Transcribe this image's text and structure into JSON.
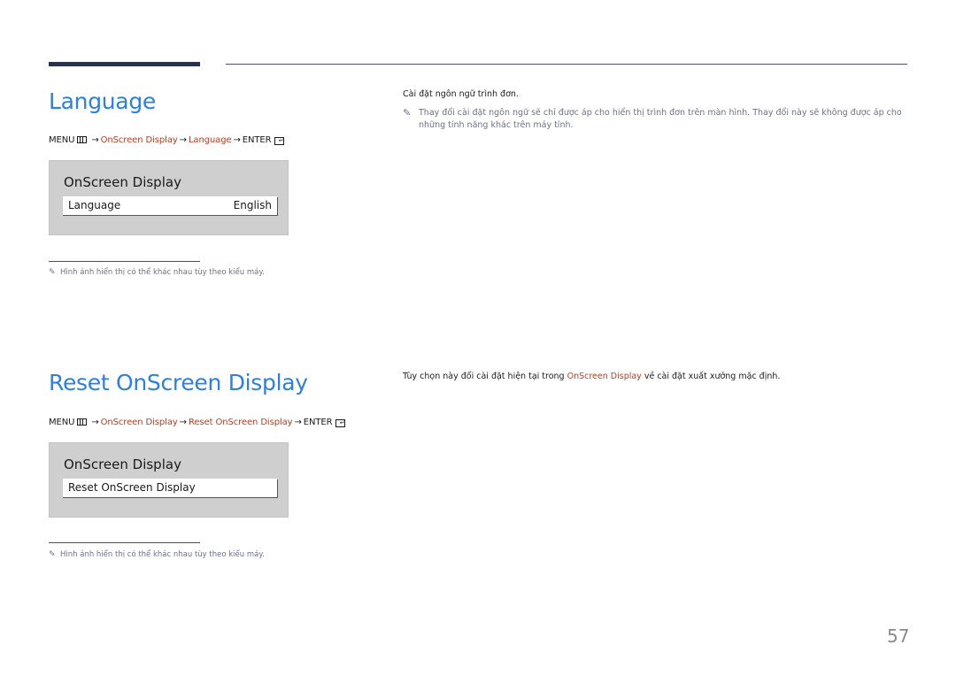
{
  "page_number": "57",
  "sections": [
    {
      "title": "Language",
      "menu_path": {
        "menu": "MENU",
        "arrow": "→",
        "step1": "OnScreen Display",
        "step2": "Language",
        "enter": "ENTER"
      },
      "osd": {
        "title": "OnScreen Display",
        "item_label": "Language",
        "item_value": "English"
      },
      "footnote": "Hình ảnh hiển thị có thể khác nhau tùy theo kiểu máy.",
      "description": "Cài đặt ngôn ngữ trình đơn.",
      "note": "Thay đổi cài đặt ngôn ngữ sẽ chỉ được áp cho hiển thị trình đơn trên màn hình. Thay đổi này sẽ không được áp cho những tính năng khác trên máy tính."
    },
    {
      "title": "Reset OnScreen Display",
      "menu_path": {
        "menu": "MENU",
        "arrow": "→",
        "step1": "OnScreen Display",
        "step2": "Reset OnScreen Display",
        "enter": "ENTER"
      },
      "osd": {
        "title": "OnScreen Display",
        "item_label": "Reset OnScreen Display"
      },
      "footnote": "Hình ảnh hiển thị có thể khác nhau tùy theo kiểu máy.",
      "description_before": "Tùy chọn này đổi cài đặt hiện tại trong ",
      "description_highlight": "OnScreen Display",
      "description_after": " về cài đặt xuất xưởng mặc định."
    }
  ],
  "colors": {
    "title_blue": "#2a7fe8",
    "highlight_red": "#c8381a",
    "note_gray": "#6a7090",
    "header_bar": "#2a3150"
  }
}
